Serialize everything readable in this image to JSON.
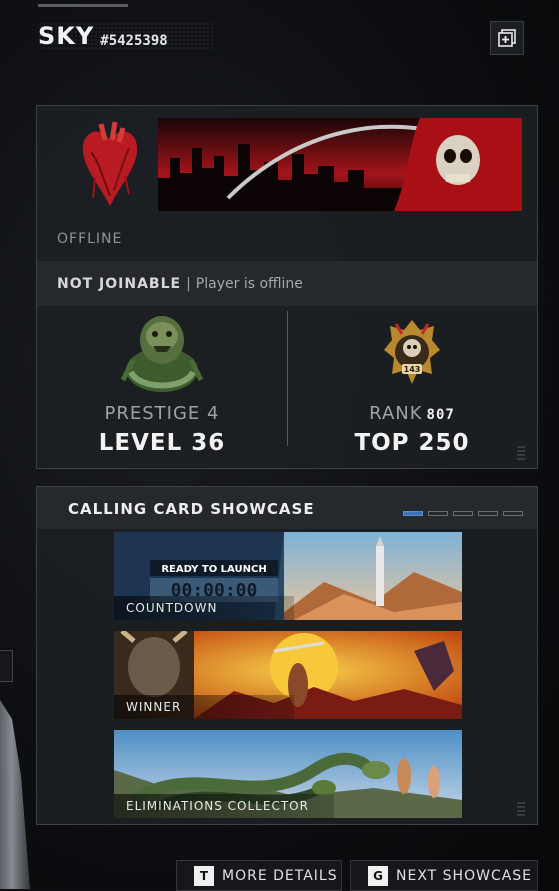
{
  "header": {
    "player_name": "SKY",
    "player_tag": "#5425398",
    "add_icon": "plus-square-icon"
  },
  "profile": {
    "emblem": "anatomical-heart-emblem",
    "banner": "grim-reaper-city-banner",
    "status": "OFFLINE",
    "joinable_label": "NOT JOINABLE",
    "joinable_separator": "|",
    "joinable_detail": "Player is offline",
    "prestige_label": "PRESTIGE 4",
    "level_label": "LEVEL 36",
    "rank_label": "RANK",
    "rank_number": "807",
    "rank_badge_number": "143",
    "top_label": "TOP 250"
  },
  "showcase": {
    "title": "CALLING CARD SHOWCASE",
    "page_count": 5,
    "active_page": 1,
    "cards": [
      {
        "label": "COUNTDOWN",
        "overlay_text": "READY TO LAUNCH",
        "timer": "00:00:00"
      },
      {
        "label": "WINNER"
      },
      {
        "label": "ELIMINATIONS COLLECTOR"
      }
    ]
  },
  "footer": {
    "more_details": {
      "key": "T",
      "label": "MORE DETAILS"
    },
    "next_showcase": {
      "key": "G",
      "label": "NEXT SHOWCASE"
    }
  },
  "colors": {
    "accent_blue": "#3f6fb5",
    "panel_bg": "#1c1f23",
    "text_primary": "#f2f2f2",
    "text_muted": "#8f9398"
  }
}
